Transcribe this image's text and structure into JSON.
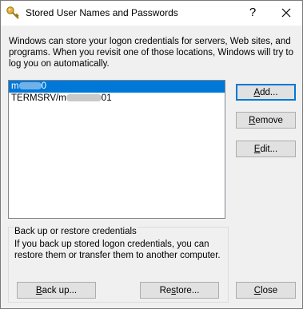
{
  "window": {
    "title": "Stored User Names and Passwords",
    "help_label": "?",
    "icon": "key-icon",
    "close_icon": "close-icon"
  },
  "description": "Windows can store your logon credentials for servers, Web sites, and programs. When you revisit one of those locations, Windows will try to log you on automatically.",
  "credentials": [
    {
      "prefix": "m",
      "suffix": "0",
      "selected": true
    },
    {
      "prefix": "TERMSRV/m",
      "suffix": "01",
      "selected": false
    }
  ],
  "buttons": {
    "add": {
      "pre": "",
      "key": "A",
      "post": "dd..."
    },
    "remove": {
      "pre": "",
      "key": "R",
      "post": "emove"
    },
    "edit": {
      "pre": "",
      "key": "E",
      "post": "dit..."
    },
    "close": {
      "pre": "",
      "key": "C",
      "post": "lose"
    },
    "backup": {
      "pre": "",
      "key": "B",
      "post": "ack up..."
    },
    "restore": {
      "pre": "Re",
      "key": "s",
      "post": "tore..."
    }
  },
  "backup_group": {
    "title": "Back up or restore credentials",
    "description": "If you back up stored logon credentials, you can restore them or transfer them to another computer."
  },
  "colors": {
    "accent": "#0078d7",
    "dialog_bg": "#f0f0f0"
  }
}
